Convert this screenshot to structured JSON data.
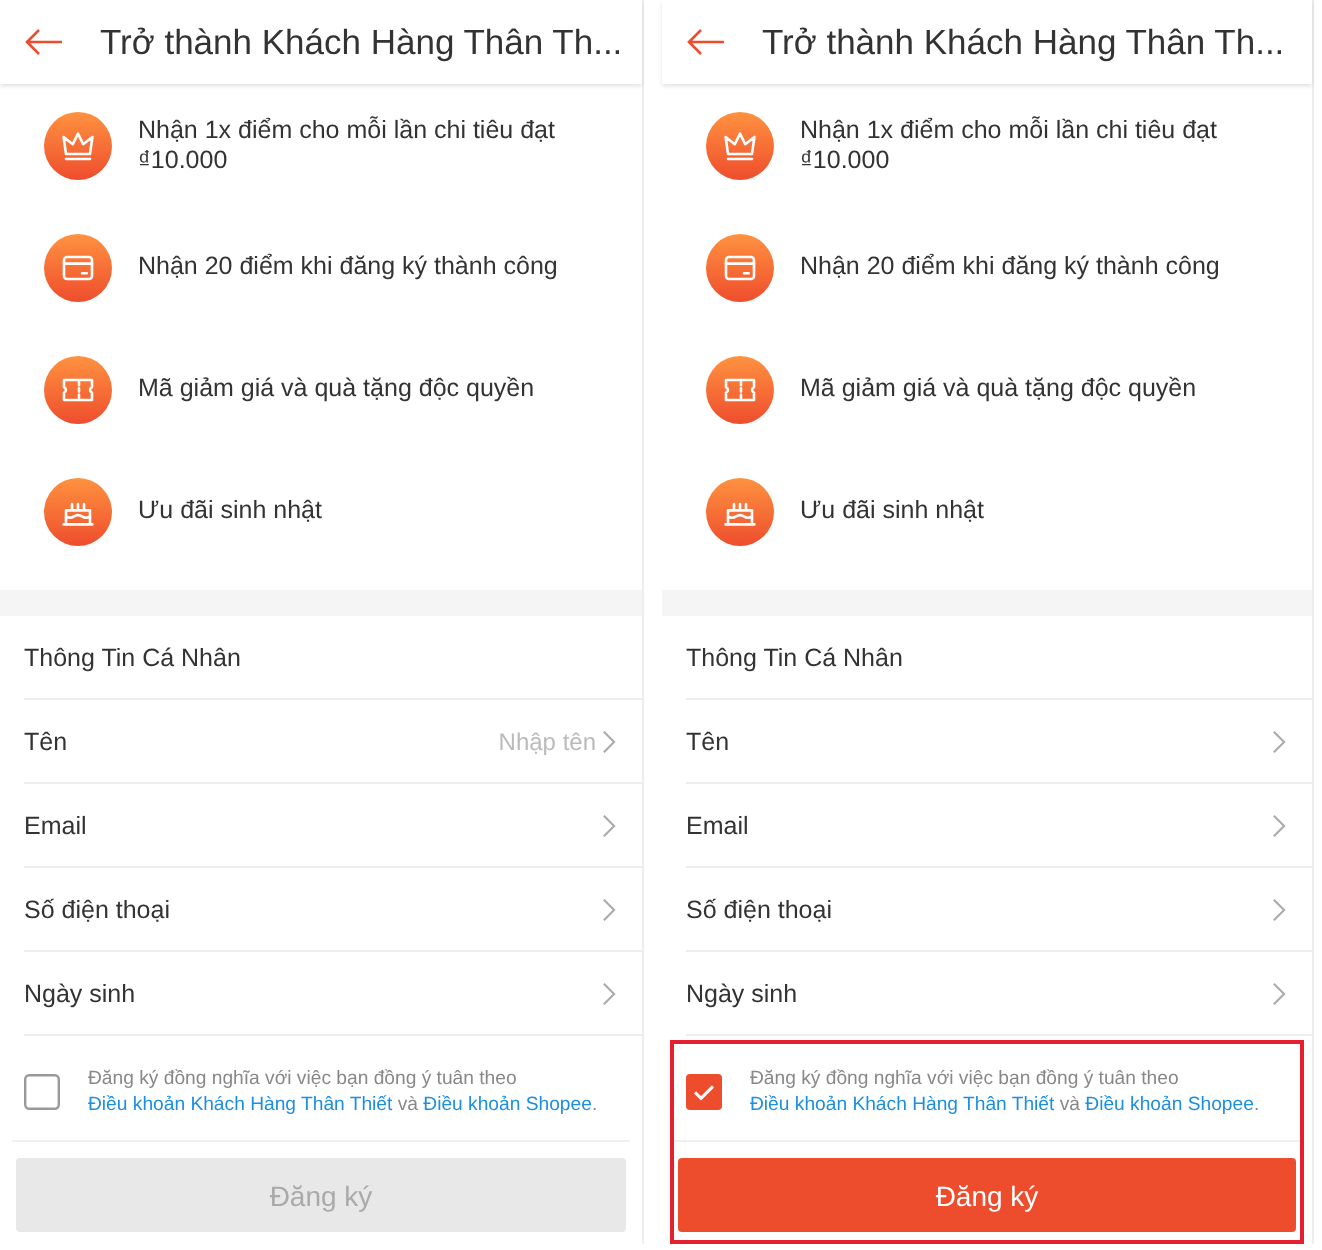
{
  "screens": [
    {
      "highlighted": false,
      "header": {
        "title": "Trở thành Khách Hàng Thân Th..."
      },
      "benefits": [
        {
          "text": "Nhận 1x điểm cho mỗi lần chi tiêu đạt ₫10.000"
        },
        {
          "text": "Nhận 20 điểm khi đăng ký thành công"
        },
        {
          "text": "Mã giảm giá và quà tặng độc quyền"
        },
        {
          "text": "Ưu đãi sinh nhật"
        }
      ],
      "section_title": "Thông Tin Cá Nhân",
      "fields": [
        {
          "label": "Tên",
          "placeholder": "Nhập tên"
        },
        {
          "label": "Email"
        },
        {
          "label": "Số điện thoại"
        },
        {
          "label": "Ngày sinh"
        }
      ],
      "agreement": {
        "checked": false,
        "parts": [
          {
            "kind": "text",
            "text": "Đăng ký đồng nghĩa với việc bạn đồng ý tuân theo "
          },
          {
            "kind": "link",
            "text": "Điều khoản Khách Hàng Thân Thiết"
          },
          {
            "kind": "text",
            "text": " và "
          },
          {
            "kind": "link",
            "text": "Điều khoản Shopee"
          },
          {
            "kind": "text",
            "text": "."
          }
        ]
      },
      "register_button": {
        "label": "Đăng ký",
        "disabled": true
      }
    },
    {
      "highlighted": true,
      "header": {
        "title": "Trở thành Khách Hàng Thân Th..."
      },
      "benefits": [
        {
          "text": "Nhận 1x điểm cho mỗi lần chi tiêu đạt ₫10.000"
        },
        {
          "text": "Nhận 20 điểm khi đăng ký thành công"
        },
        {
          "text": "Mã giảm giá và quà tặng độc quyền"
        },
        {
          "text": "Ưu đãi sinh nhật"
        }
      ],
      "section_title": "Thông Tin Cá Nhân",
      "fields": [
        {
          "label": "Tên"
        },
        {
          "label": "Email"
        },
        {
          "label": "Số điện thoại"
        },
        {
          "label": "Ngày sinh"
        }
      ],
      "agreement": {
        "checked": true,
        "parts": [
          {
            "kind": "text",
            "text": "Đăng ký đồng nghĩa với việc bạn đồng ý tuân theo "
          },
          {
            "kind": "link",
            "text": "Điều khoản Khách Hàng Thân Thiết"
          },
          {
            "kind": "text",
            "text": " và "
          },
          {
            "kind": "link",
            "text": "Điều khoản Shopee"
          },
          {
            "kind": "text",
            "text": "."
          }
        ]
      },
      "register_button": {
        "label": "Đăng ký",
        "disabled": false
      }
    }
  ]
}
